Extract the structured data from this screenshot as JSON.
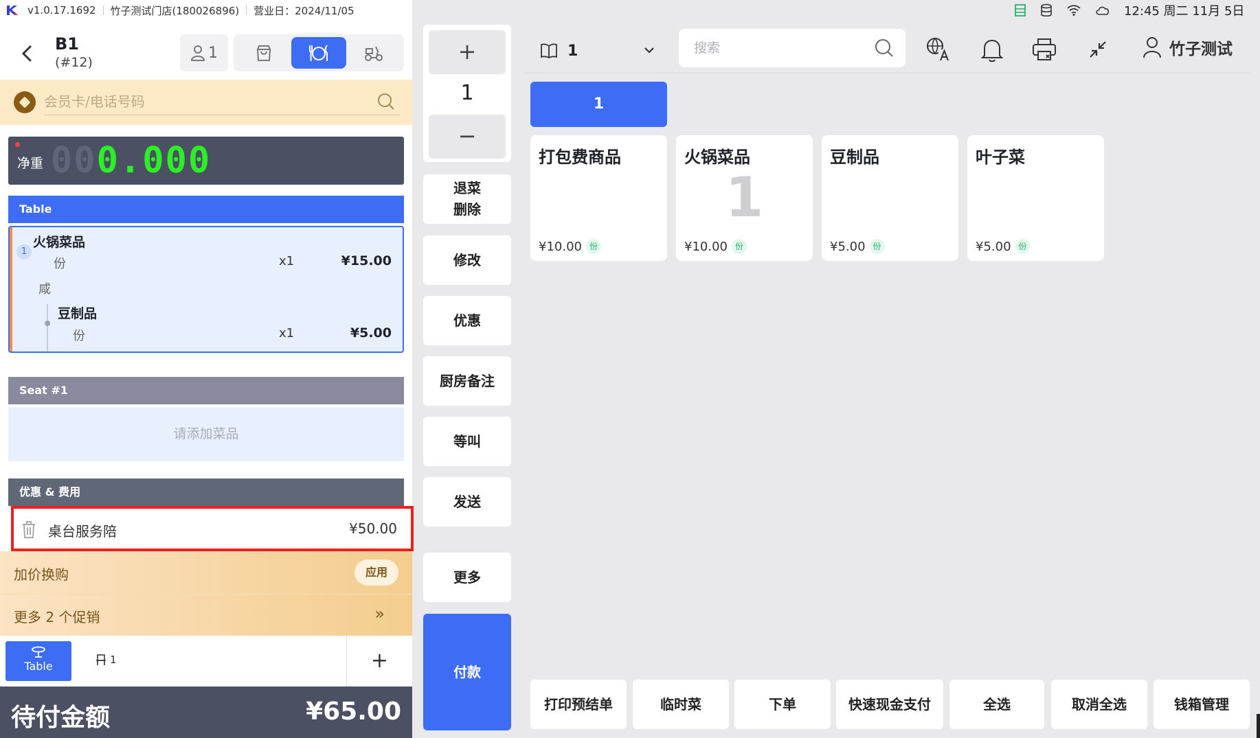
{
  "status_bar": {
    "version": "v1.0.17.1692",
    "store": "竹子测试门店(180026896)",
    "business_day": "营业日：2024/11/05",
    "time": "12:45 周二 11月 5日",
    "icons": [
      "sheet-icon",
      "database-icon",
      "wifi-icon",
      "cloud-icon"
    ]
  },
  "table_header": {
    "table_name": "B1",
    "order_no": "(#12)",
    "guest_count": "1",
    "modes": [
      "takeaway-bag-icon",
      "dine-in-icon",
      "delivery-scooter-icon"
    ],
    "active_mode": "dine-in-icon"
  },
  "member": {
    "placeholder": "会员卡/电话号码"
  },
  "scale": {
    "label": "净重",
    "ghost_digits": "00",
    "value": "0.000"
  },
  "sections": {
    "table": "Table",
    "seat": "Seat #1",
    "promo": "优惠 & 费用"
  },
  "order_items": [
    {
      "index": "1",
      "name": "火锅菜品",
      "unit": "份",
      "qty": "x1",
      "price": "¥15.00",
      "modifier": "咸"
    },
    {
      "name": "豆制品",
      "unit": "份",
      "qty": "x1",
      "price": "¥5.00"
    }
  ],
  "seat_empty_text": "请添加菜品",
  "fee": {
    "name": "桌台服务陪",
    "amount": "¥50.00"
  },
  "upsell": {
    "label": "加价换购",
    "apply": "应用"
  },
  "more_promo": {
    "label": "更多 2 个促销",
    "chevron": "»"
  },
  "bottom_tabs": {
    "table": "Table",
    "seat_count": "1",
    "add": "+"
  },
  "total": {
    "label": "待付金额",
    "amount": "¥65.00"
  },
  "qty_stepper": {
    "plus": "+",
    "value": "1",
    "minus": "−"
  },
  "actions": {
    "void_line1": "退菜",
    "void_line2": "删除",
    "modify": "修改",
    "discount": "优惠",
    "kitchen_note": "厨房备注",
    "hold": "等叫",
    "send": "发送",
    "more": "更多",
    "pay": "付款"
  },
  "top_nav": {
    "menu_value": "1",
    "search_placeholder": "搜索",
    "user_name": "竹子测试",
    "icons": [
      "translate-icon",
      "bell-icon",
      "printer-icon",
      "collapse-icon"
    ]
  },
  "category": {
    "selected": "1"
  },
  "products": [
    {
      "name": "打包费商品",
      "price": "¥10.00",
      "unit": "份",
      "count": ""
    },
    {
      "name": "火锅菜品",
      "price": "¥10.00",
      "unit": "份",
      "count": "1"
    },
    {
      "name": "豆制品",
      "price": "¥5.00",
      "unit": "份",
      "count": ""
    },
    {
      "name": "叶子菜",
      "price": "¥5.00",
      "unit": "份",
      "count": ""
    }
  ],
  "bottom_actions": [
    "打印预结单",
    "临时菜",
    "下单",
    "快速现金支付",
    "全选",
    "取消全选",
    "钱箱管理"
  ],
  "colors": {
    "primary": "#3e6df5",
    "dark": "#4b5163",
    "highlight_border": "#ed2020",
    "promo_gold": "#f4cd8e",
    "scale_green": "#2bf026"
  }
}
